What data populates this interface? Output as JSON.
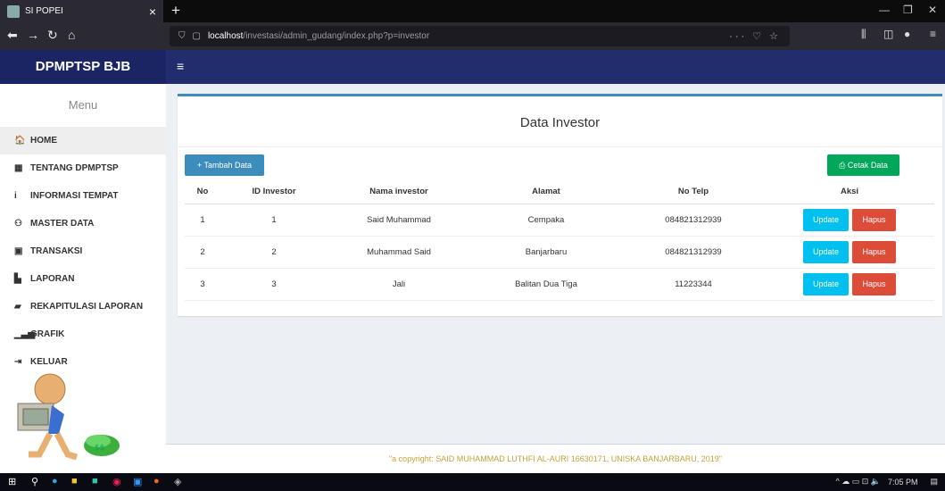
{
  "browser": {
    "tab_title": "SI POPEI",
    "tab_close": "×",
    "new_tab": "+",
    "url_host": "localhost",
    "url_path": "/investasi/admin_gudang/index.php?p=investor"
  },
  "app": {
    "brand": "DPMPTSP BJB",
    "menu_header": "Menu",
    "menu": [
      {
        "label": "HOME",
        "icon": "home-icon",
        "glyph": "🏠"
      },
      {
        "label": "TENTANG DPMPTSP",
        "icon": "building-icon",
        "glyph": "▦"
      },
      {
        "label": "INFORMASI TEMPAT",
        "icon": "info-icon",
        "glyph": "i"
      },
      {
        "label": "MASTER DATA",
        "icon": "users-icon",
        "glyph": "⚇"
      },
      {
        "label": "TRANSAKSI",
        "icon": "money-icon",
        "glyph": "▣"
      },
      {
        "label": "LAPORAN",
        "icon": "file-icon",
        "glyph": "▙"
      },
      {
        "label": "REKAPITULASI LAPORAN",
        "icon": "book-icon",
        "glyph": "▰"
      },
      {
        "label": "GRAFIK",
        "icon": "bar-chart-icon",
        "glyph": "▁▃▅"
      },
      {
        "label": "KELUAR",
        "icon": "sign-out-icon",
        "glyph": "⇥"
      }
    ]
  },
  "panel": {
    "title": "Data Investor",
    "add_button": "+ Tambah Data",
    "print_button": "⎙ Cetak Data",
    "columns": [
      "No",
      "ID Investor",
      "Nama investor",
      "Alamat",
      "No Telp",
      "Aksi"
    ],
    "rows": [
      {
        "no": "1",
        "id": "1",
        "nama": "Said Muhammad",
        "alamat": "Cempaka",
        "telp": "084821312939"
      },
      {
        "no": "2",
        "id": "2",
        "nama": "Muhammad Said",
        "alamat": "Banjarbaru",
        "telp": "084821312939"
      },
      {
        "no": "3",
        "id": "3",
        "nama": "Jali",
        "alamat": "Balitan Dua Tiga",
        "telp": "11223344"
      }
    ],
    "update_label": "Update",
    "delete_label": "Hapus"
  },
  "footer": "\"a copyright: SAID MUHAMMAD LUTHFI AL-AURI 16630171, UNISKA BANJARBARU, 2019\"",
  "taskbar": {
    "time": "7:05 PM"
  }
}
